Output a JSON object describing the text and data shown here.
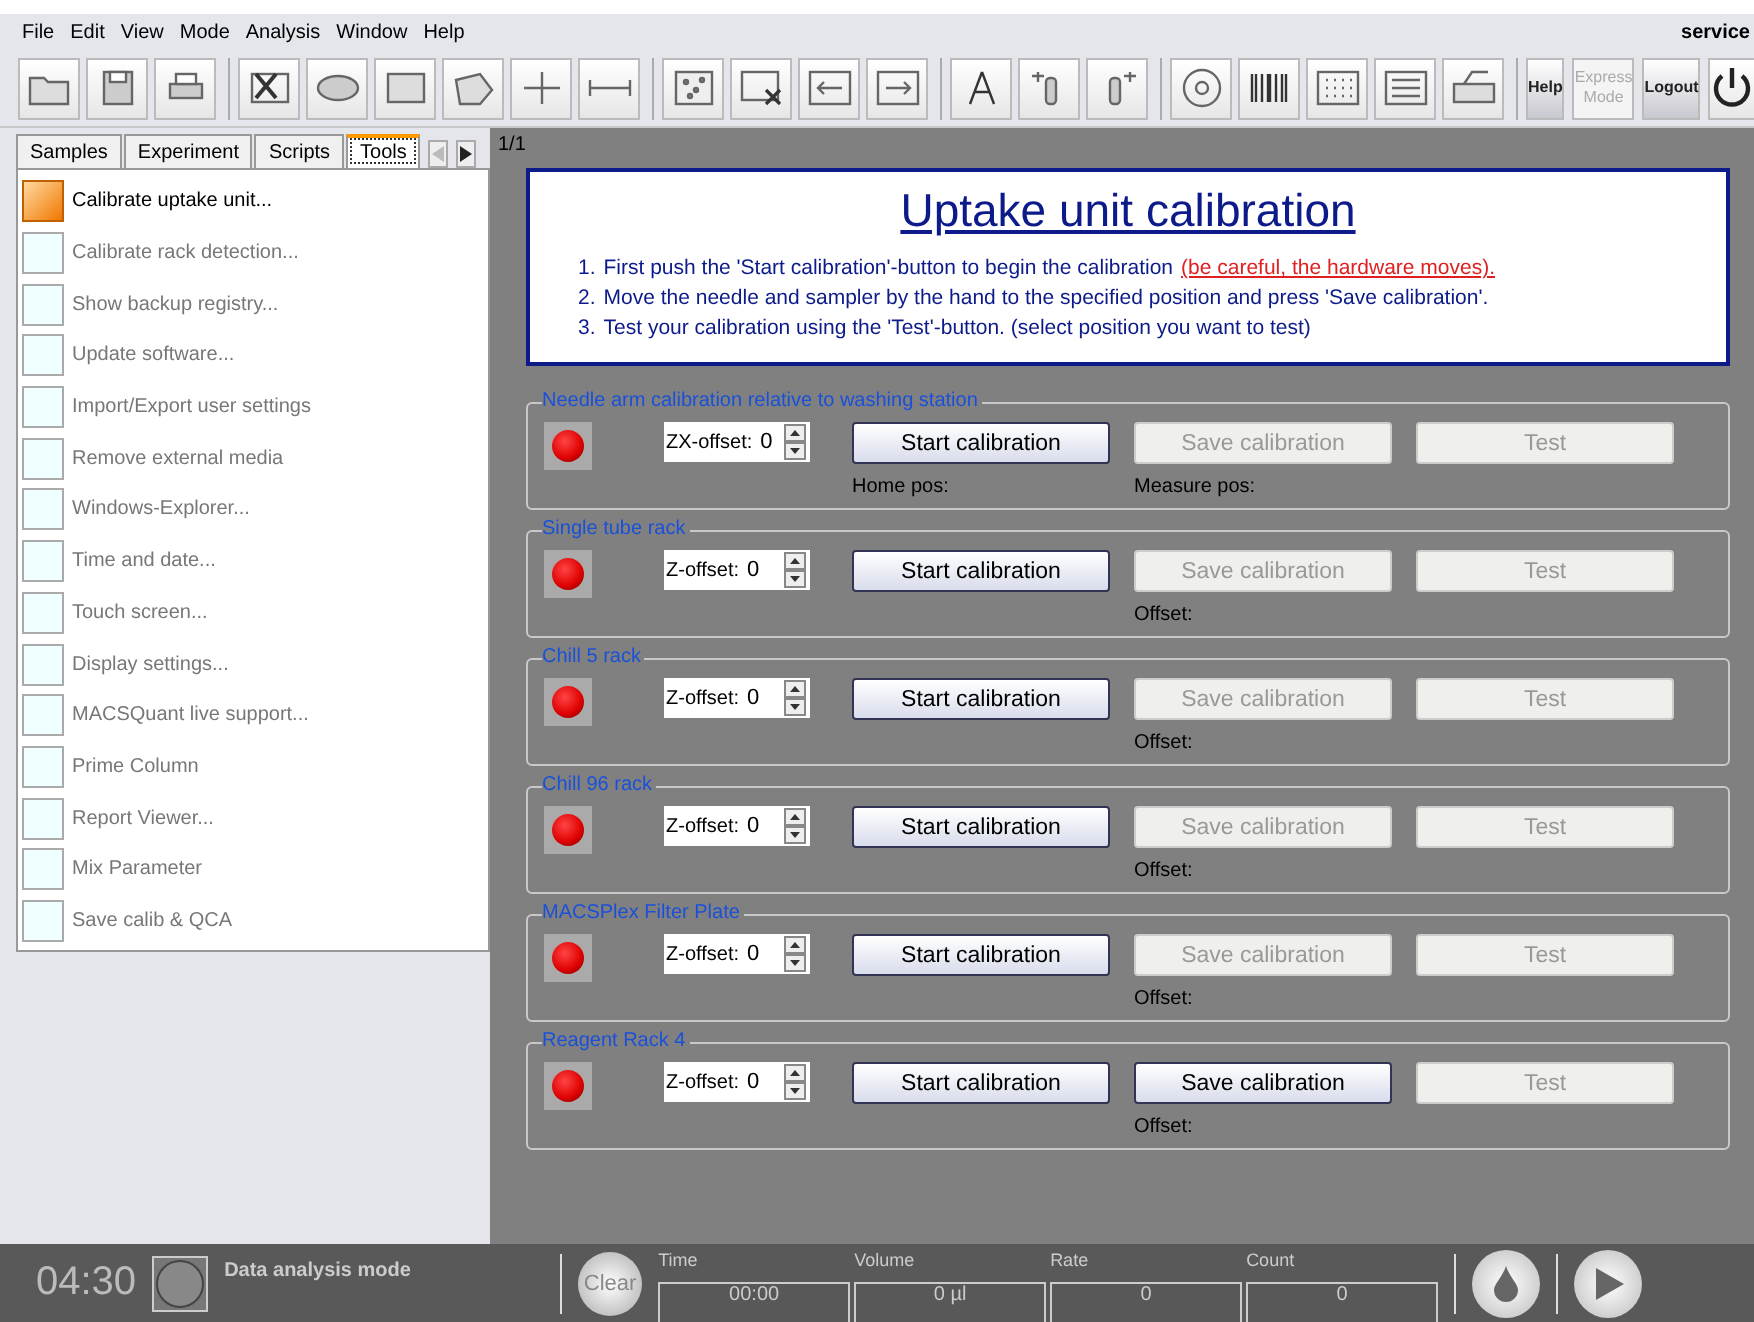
{
  "menu": [
    "File",
    "Edit",
    "View",
    "Mode",
    "Analysis",
    "Window",
    "Help"
  ],
  "user": "service",
  "toolbar_buttons": [
    {
      "label": "Help",
      "disabled": false
    },
    {
      "label": "Express Mode",
      "disabled": true
    },
    {
      "label": "Logout",
      "disabled": false
    }
  ],
  "tabs": [
    {
      "label": "Samples",
      "selected": false
    },
    {
      "label": "Experiment",
      "selected": false
    },
    {
      "label": "Scripts",
      "selected": false
    },
    {
      "label": "Tools",
      "selected": true
    }
  ],
  "page_indicator": "1/1",
  "sidebar": {
    "items": [
      {
        "label": "Calibrate uptake unit...",
        "selected": true
      },
      {
        "label": "Calibrate rack detection...",
        "selected": false
      },
      {
        "label": "Show backup registry...",
        "selected": false
      },
      {
        "label": "Update software...",
        "selected": false
      },
      {
        "label": "Import/Export user settings",
        "selected": false
      },
      {
        "label": "Remove external media",
        "selected": false
      },
      {
        "label": "Windows-Explorer...",
        "selected": false
      },
      {
        "label": "Time and date...",
        "selected": false
      },
      {
        "label": "Touch screen...",
        "selected": false
      },
      {
        "label": "Display settings...",
        "selected": false
      },
      {
        "label": "MACSQuant live support...",
        "selected": false
      },
      {
        "label": "Prime Column",
        "selected": false
      },
      {
        "label": "Report Viewer...",
        "selected": false
      },
      {
        "label": "Mix Parameter",
        "selected": false
      },
      {
        "label": "Save calib & QCA",
        "selected": false
      }
    ]
  },
  "header": {
    "title": "Uptake unit calibration",
    "steps": [
      {
        "number": "1.",
        "text": "First push the 'Start calibration'-button to begin the calibration"
      },
      {
        "number": "2.",
        "text": "Move the needle and sampler by the hand to the specified position and press 'Save calibration'."
      },
      {
        "number": "3.",
        "text": "Test your calibration using the 'Test'-button. (select position you want to test)"
      }
    ],
    "warning": "(be careful, the hardware moves)."
  },
  "sections": [
    {
      "title": "Needle arm calibration relative to washing station",
      "offset_label": "ZX-offset:",
      "offset_value": "0",
      "start": {
        "label": "Start calibration",
        "disabled": false
      },
      "save": {
        "label": "Save calibration",
        "disabled": true
      },
      "test": {
        "label": "Test",
        "disabled": true
      },
      "start_note": "Home pos:",
      "save_note": "Measure pos:"
    },
    {
      "title": "Single tube rack",
      "offset_label": "Z-offset:",
      "offset_value": "0",
      "start": {
        "label": "Start calibration",
        "disabled": false
      },
      "save": {
        "label": "Save calibration",
        "disabled": true
      },
      "test": {
        "label": "Test",
        "disabled": true
      },
      "save_note": "Offset:"
    },
    {
      "title": "Chill 5 rack",
      "offset_label": "Z-offset:",
      "offset_value": "0",
      "start": {
        "label": "Start calibration",
        "disabled": false
      },
      "save": {
        "label": "Save calibration",
        "disabled": true
      },
      "test": {
        "label": "Test",
        "disabled": true
      },
      "save_note": "Offset:"
    },
    {
      "title": "Chill 96 rack",
      "offset_label": "Z-offset:",
      "offset_value": "0",
      "start": {
        "label": "Start calibration",
        "disabled": false
      },
      "save": {
        "label": "Save calibration",
        "disabled": true
      },
      "test": {
        "label": "Test",
        "disabled": true
      },
      "save_note": "Offset:"
    },
    {
      "title": "MACSPlex Filter Plate",
      "offset_label": "Z-offset:",
      "offset_value": "0",
      "start": {
        "label": "Start calibration",
        "disabled": false
      },
      "save": {
        "label": "Save calibration",
        "disabled": true
      },
      "test": {
        "label": "Test",
        "disabled": true
      },
      "save_note": "Offset:"
    },
    {
      "title": "Reagent Rack 4",
      "offset_label": "Z-offset:",
      "offset_value": "0",
      "start": {
        "label": "Start calibration",
        "disabled": false
      },
      "save": {
        "label": "Save calibration",
        "disabled": false
      },
      "test": {
        "label": "Test",
        "disabled": true
      },
      "save_note": "Offset:"
    }
  ],
  "status_bar": {
    "clock": "04:30",
    "mode": "Data analysis mode",
    "clear_button": "Clear",
    "fields": [
      {
        "label": "Time",
        "value": "00:00"
      },
      {
        "label": "Volume",
        "value": "0 µl"
      },
      {
        "label": "Rate",
        "value": "0"
      },
      {
        "label": "Count",
        "value": "0"
      }
    ]
  }
}
